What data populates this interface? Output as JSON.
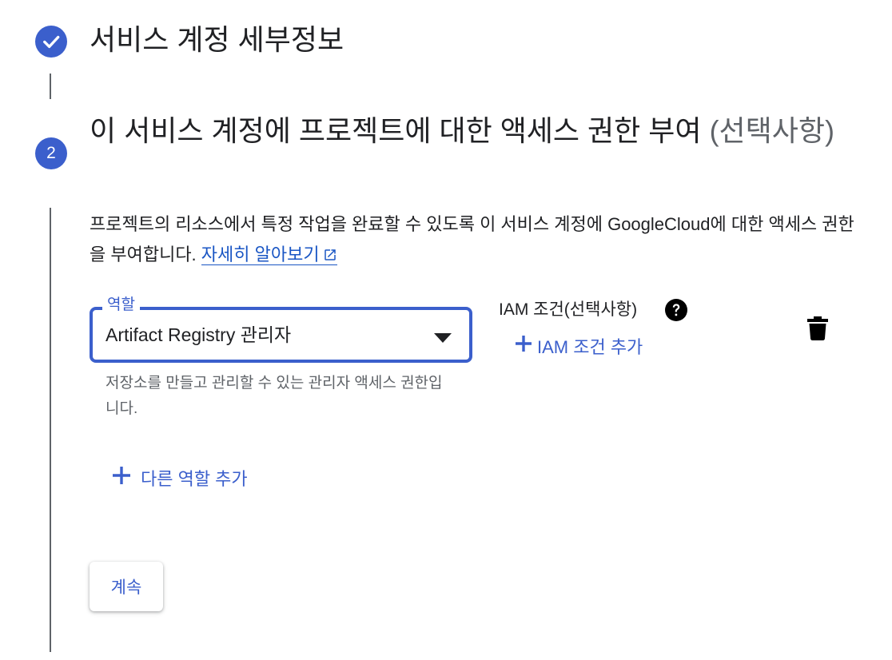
{
  "step1": {
    "title": "서비스 계정 세부정보",
    "status_icon": "check-circle-icon"
  },
  "step2": {
    "number": "2",
    "title": "이 서비스 계정에 프로젝트에 대한 액세스 권한 부여",
    "optional": "(선택사항)",
    "description": "프로젝트의 리소스에서 특정 작업을 완료할 수 있도록 이 서비스 계정에 GoogleCloud에 대한 액세스 권한을 부여합니다.",
    "learn_more": "자세히 알아보기"
  },
  "role": {
    "label": "역할",
    "value": "Artifact Registry 관리자",
    "help": "저장소를 만들고 관리할 수 있는 관리자 액세스 권한입니다."
  },
  "iam": {
    "label": "IAM 조건(선택사항)",
    "add_label": "IAM 조건 추가"
  },
  "add_role_label": "다른 역할 추가",
  "continue_label": "계속",
  "colors": {
    "accent": "#3b5fcc",
    "link": "#1a56c4",
    "text": "#202124",
    "secondary_text": "#5f6368"
  }
}
